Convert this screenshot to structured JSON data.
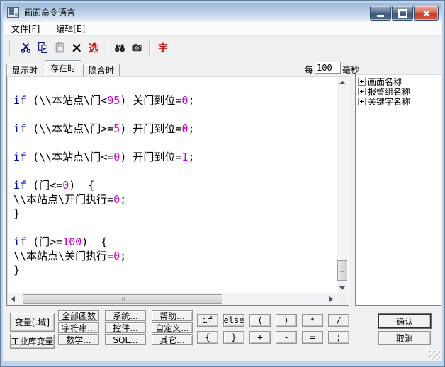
{
  "window": {
    "title": "画面命令语言",
    "controls": {
      "minimize": "minimize",
      "maximize": "maximize",
      "close": "close"
    }
  },
  "menu": {
    "items": [
      "文件[F]",
      "编辑[E]"
    ]
  },
  "toolbar": {
    "select_label": "选",
    "font_label": "字",
    "icon_names": [
      "cut-icon",
      "copy-icon",
      "paste-icon",
      "delete-icon",
      "select-text-button",
      "find-icon",
      "camera-icon",
      "font-button"
    ],
    "accent_red": "#cc0000",
    "icon_navy": "#000080"
  },
  "tabs": {
    "items": [
      "显示时",
      "存在时",
      "隐含时"
    ],
    "active": "存在时"
  },
  "interval": {
    "prefix": "每",
    "value": "100",
    "suffix": "毫秒"
  },
  "editor": {
    "colors": {
      "k": "#0000cc",
      "n": "#cc00cc",
      "p": "#000000"
    },
    "background": "#ffffff",
    "lines": [
      [],
      [
        {
          "c": "k",
          "t": "if"
        },
        {
          "c": "p",
          "t": " (\\\\本站点\\门<"
        },
        {
          "c": "n",
          "t": "95"
        },
        {
          "c": "p",
          "t": ") 关门到位="
        },
        {
          "c": "n",
          "t": "0"
        },
        {
          "c": "p",
          "t": ";"
        }
      ],
      [],
      [
        {
          "c": "k",
          "t": "if"
        },
        {
          "c": "p",
          "t": " (\\\\本站点\\门>="
        },
        {
          "c": "n",
          "t": "5"
        },
        {
          "c": "p",
          "t": ") 开门到位="
        },
        {
          "c": "n",
          "t": "0"
        },
        {
          "c": "p",
          "t": ";"
        }
      ],
      [],
      [
        {
          "c": "k",
          "t": "if"
        },
        {
          "c": "p",
          "t": " (\\\\本站点\\门<="
        },
        {
          "c": "n",
          "t": "0"
        },
        {
          "c": "p",
          "t": ") 开门到位="
        },
        {
          "c": "n",
          "t": "1"
        },
        {
          "c": "p",
          "t": ";"
        }
      ],
      [],
      [
        {
          "c": "k",
          "t": "if"
        },
        {
          "c": "p",
          "t": " (门<="
        },
        {
          "c": "n",
          "t": "0"
        },
        {
          "c": "p",
          "t": ")  {"
        }
      ],
      [
        {
          "c": "p",
          "t": "\\\\本站点\\开门执行="
        },
        {
          "c": "n",
          "t": "0"
        },
        {
          "c": "p",
          "t": ";"
        }
      ],
      [
        {
          "c": "p",
          "t": "}"
        }
      ],
      [],
      [
        {
          "c": "k",
          "t": "if"
        },
        {
          "c": "p",
          "t": " (门>="
        },
        {
          "c": "n",
          "t": "100"
        },
        {
          "c": "p",
          "t": ")  {"
        }
      ],
      [
        {
          "c": "p",
          "t": "\\\\本站点\\关门执行="
        },
        {
          "c": "n",
          "t": "0"
        },
        {
          "c": "p",
          "t": ";"
        }
      ],
      [
        {
          "c": "p",
          "t": "}"
        }
      ]
    ]
  },
  "tree": {
    "items": [
      "画面名称",
      "报警组名称",
      "关键字名称"
    ]
  },
  "bottom": {
    "left_buttons": [
      "变量[.域]",
      "工业库变量"
    ],
    "function_buttons": [
      "全部函数",
      "系统...",
      "帮助...",
      "字符串...",
      "控件...",
      "自定义...",
      "数学...",
      "SQL...",
      "其它..."
    ],
    "operator_buttons": [
      "if",
      "else",
      "(",
      ")",
      "*",
      "/",
      "{",
      "}",
      "+",
      "-",
      "=",
      ";"
    ],
    "ok": "确认",
    "cancel": "取消"
  }
}
